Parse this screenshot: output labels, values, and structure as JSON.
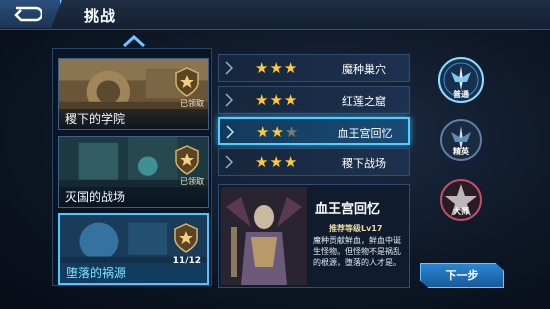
{
  "header": {
    "title": "挑战"
  },
  "levels": [
    {
      "name": "稷下的学院",
      "status": "已领取",
      "progress": ""
    },
    {
      "name": "灭国的战场",
      "status": "已领取",
      "progress": ""
    },
    {
      "name": "堕落的祸源",
      "status": "",
      "progress": "11/12"
    }
  ],
  "stages": [
    {
      "name": "魔种巢穴",
      "stars": 3
    },
    {
      "name": "红莲之窟",
      "stars": 3
    },
    {
      "name": "血王宫回忆",
      "stars": 2
    },
    {
      "name": "稷下战场",
      "stars": 3
    }
  ],
  "detail": {
    "title": "血王宫回忆",
    "recommended": "推荐等级Lv17",
    "description": "魔种贡献鲜血，鲜血中诞生怪物。但怪物不是祸乱的根源，堕落的人才是。"
  },
  "difficulties": [
    {
      "label": "普通"
    },
    {
      "label": "精英"
    },
    {
      "label": "大师"
    }
  ],
  "actions": {
    "next": "下一步"
  }
}
